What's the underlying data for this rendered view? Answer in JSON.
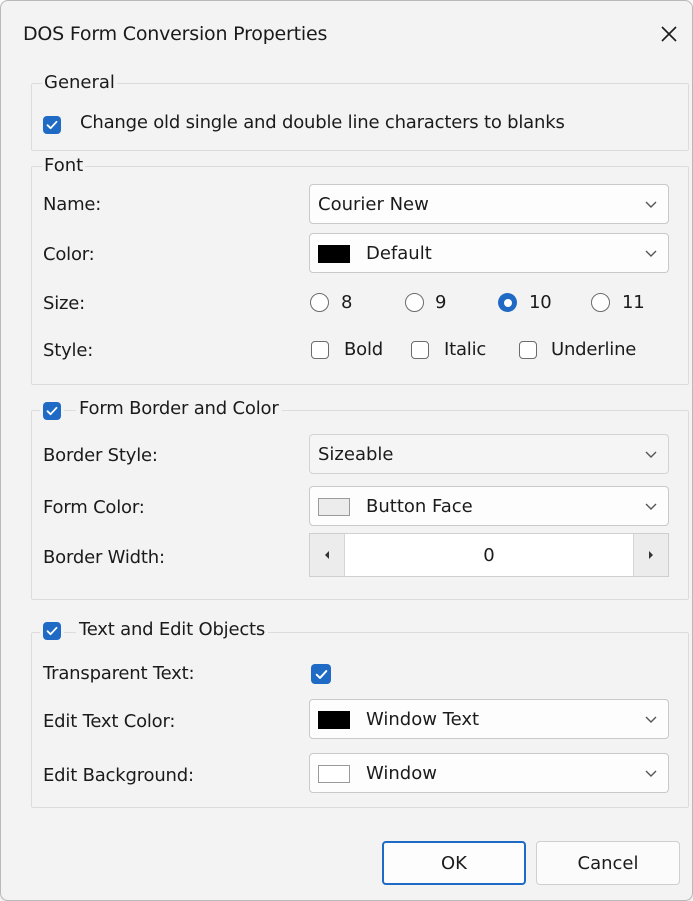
{
  "dialog": {
    "title": "DOS Form Conversion Properties"
  },
  "general": {
    "legend": "General",
    "change_lines": {
      "label": "Change old single and double line characters to blanks",
      "checked": true
    }
  },
  "font": {
    "legend": "Font",
    "name": {
      "label": "Name:",
      "value": "Courier New"
    },
    "color": {
      "label": "Color:",
      "value": "Default",
      "swatch": "#000000"
    },
    "size": {
      "label": "Size:",
      "options": [
        "8",
        "9",
        "10",
        "11"
      ],
      "selected": "10"
    },
    "style": {
      "label": "Style:",
      "bold": "Bold",
      "italic": "Italic",
      "underline": "Underline"
    }
  },
  "form_border": {
    "legend": "Form Border and Color",
    "checked": true,
    "border_style": {
      "label": "Border Style:",
      "value": "Sizeable"
    },
    "form_color": {
      "label": "Form Color:",
      "value": "Button Face",
      "swatch": "#ececec"
    },
    "border_width": {
      "label": "Border Width:",
      "value": "0"
    }
  },
  "text_edit": {
    "legend": "Text and Edit Objects",
    "checked": true,
    "transparent_text": {
      "label": "Transparent Text:",
      "checked": true
    },
    "edit_text_color": {
      "label": "Edit Text Color:",
      "value": "Window Text",
      "swatch": "#000000"
    },
    "edit_background": {
      "label": "Edit Background:",
      "value": "Window",
      "swatch": "#ffffff"
    }
  },
  "buttons": {
    "ok": "OK",
    "cancel": "Cancel"
  },
  "colors": {
    "accent": "#1f6ac4",
    "dialog_bg": "#f3f3f3"
  }
}
